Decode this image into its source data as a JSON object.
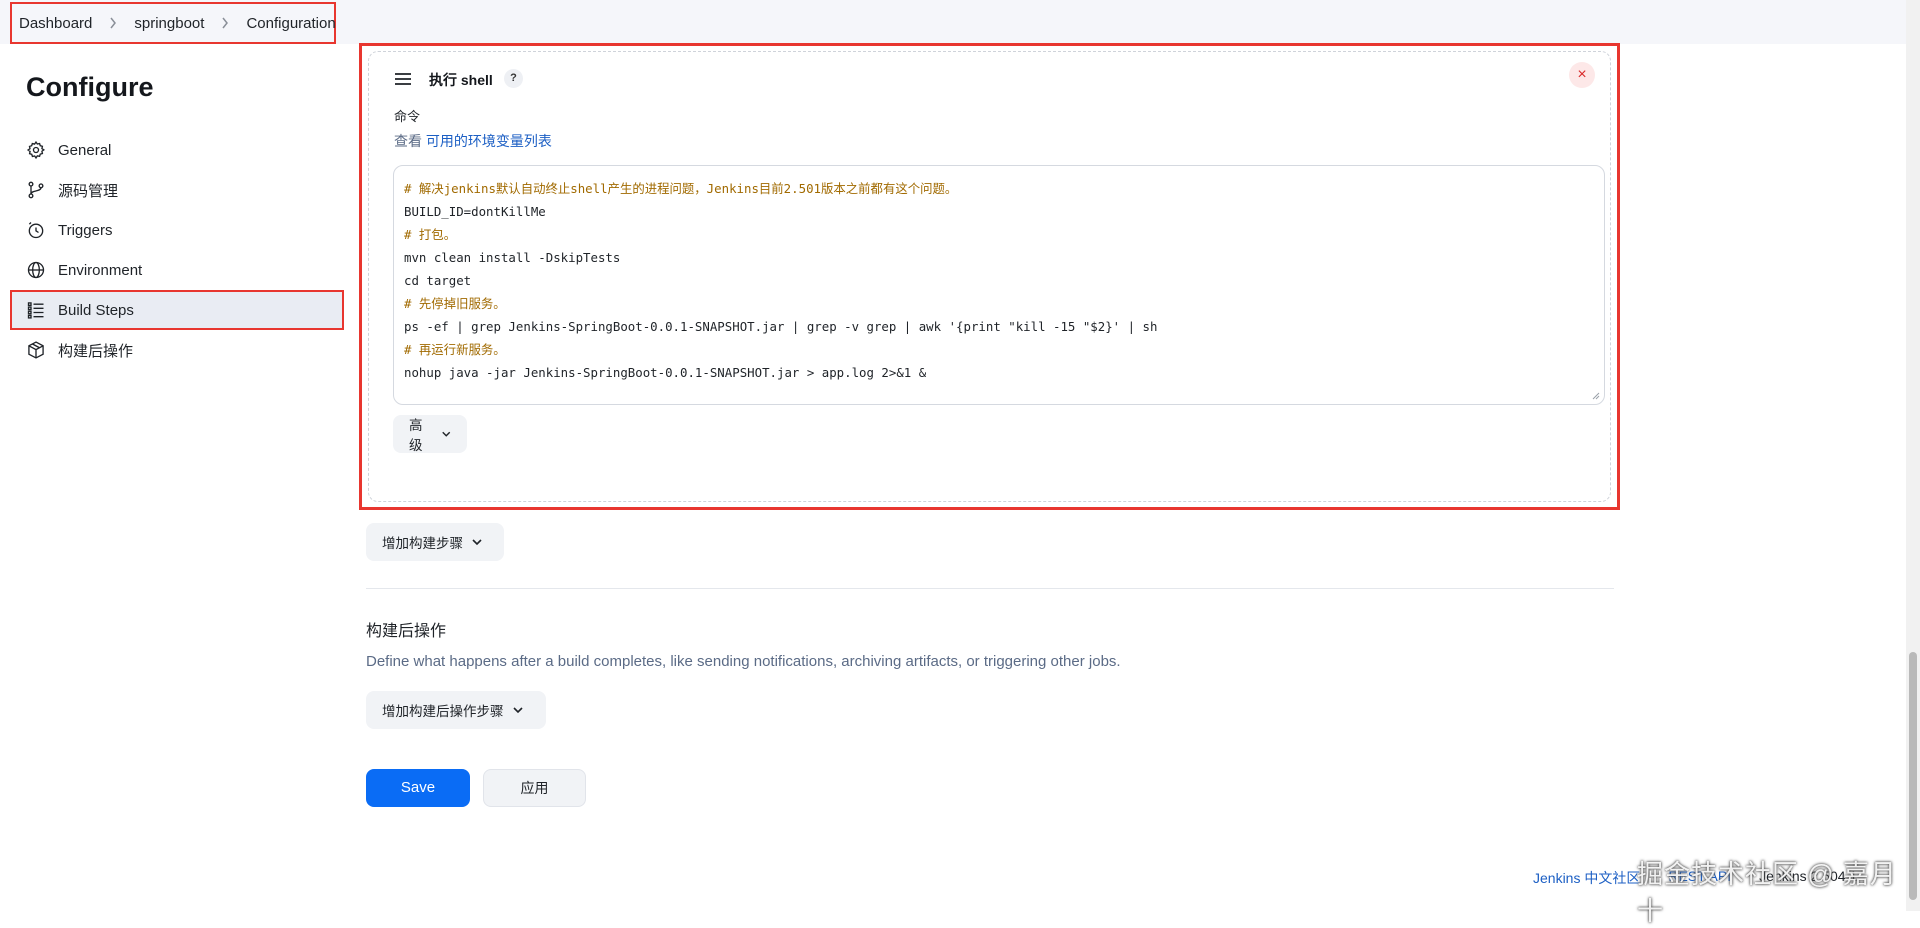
{
  "breadcrumb": [
    "Dashboard",
    "springboot",
    "Configuration"
  ],
  "sidebar": {
    "title": "Configure",
    "items": [
      {
        "label": "General",
        "icon": "gear-icon",
        "active": false
      },
      {
        "label": "源码管理",
        "icon": "branch-icon",
        "active": false
      },
      {
        "label": "Triggers",
        "icon": "clock-icon",
        "active": false
      },
      {
        "label": "Environment",
        "icon": "globe-icon",
        "active": false
      },
      {
        "label": "Build Steps",
        "icon": "list-icon",
        "active": true
      },
      {
        "label": "构建后操作",
        "icon": "package-icon",
        "active": false
      }
    ]
  },
  "step": {
    "title": "执行 shell",
    "help": "?",
    "close": "×",
    "command_label": "命令",
    "env_prefix": "查看",
    "env_link": "可用的环境变量列表",
    "code_lines": [
      "# 解决jenkins默认自动终止shell产生的进程问题，Jenkins目前2.501版本之前都有这个问题。",
      "BUILD_ID=dontKillMe",
      "# 打包。",
      "mvn clean install -DskipTests",
      "cd target",
      "# 先停掉旧服务。",
      "ps -ef | grep Jenkins-SpringBoot-0.0.1-SNAPSHOT.jar | grep -v grep | awk '{print \"kill -15 \"$2}' | sh",
      "# 再运行新服务。",
      "nohup java -jar Jenkins-SpringBoot-0.0.1-SNAPSHOT.jar > app.log 2>&1 &"
    ],
    "advanced_label": "高级"
  },
  "add_build_step_label": "增加构建步骤",
  "post_build": {
    "title": "构建后操作",
    "description": "Define what happens after a build completes, like sending notifications, archiving artifacts, or triggering other jobs.",
    "add_label": "增加构建后操作步骤"
  },
  "actions": {
    "save": "Save",
    "apply": "应用"
  },
  "footer": {
    "community": "Jenkins 中文社区",
    "rest_api": "REST API",
    "version": "Jenkins 2.504.1"
  },
  "watermark": "掘金技术社区 @ 嘉月十",
  "colors": {
    "accent": "#0a6cf5",
    "highlight_border": "#e8362f",
    "link": "#1c5fc4"
  }
}
